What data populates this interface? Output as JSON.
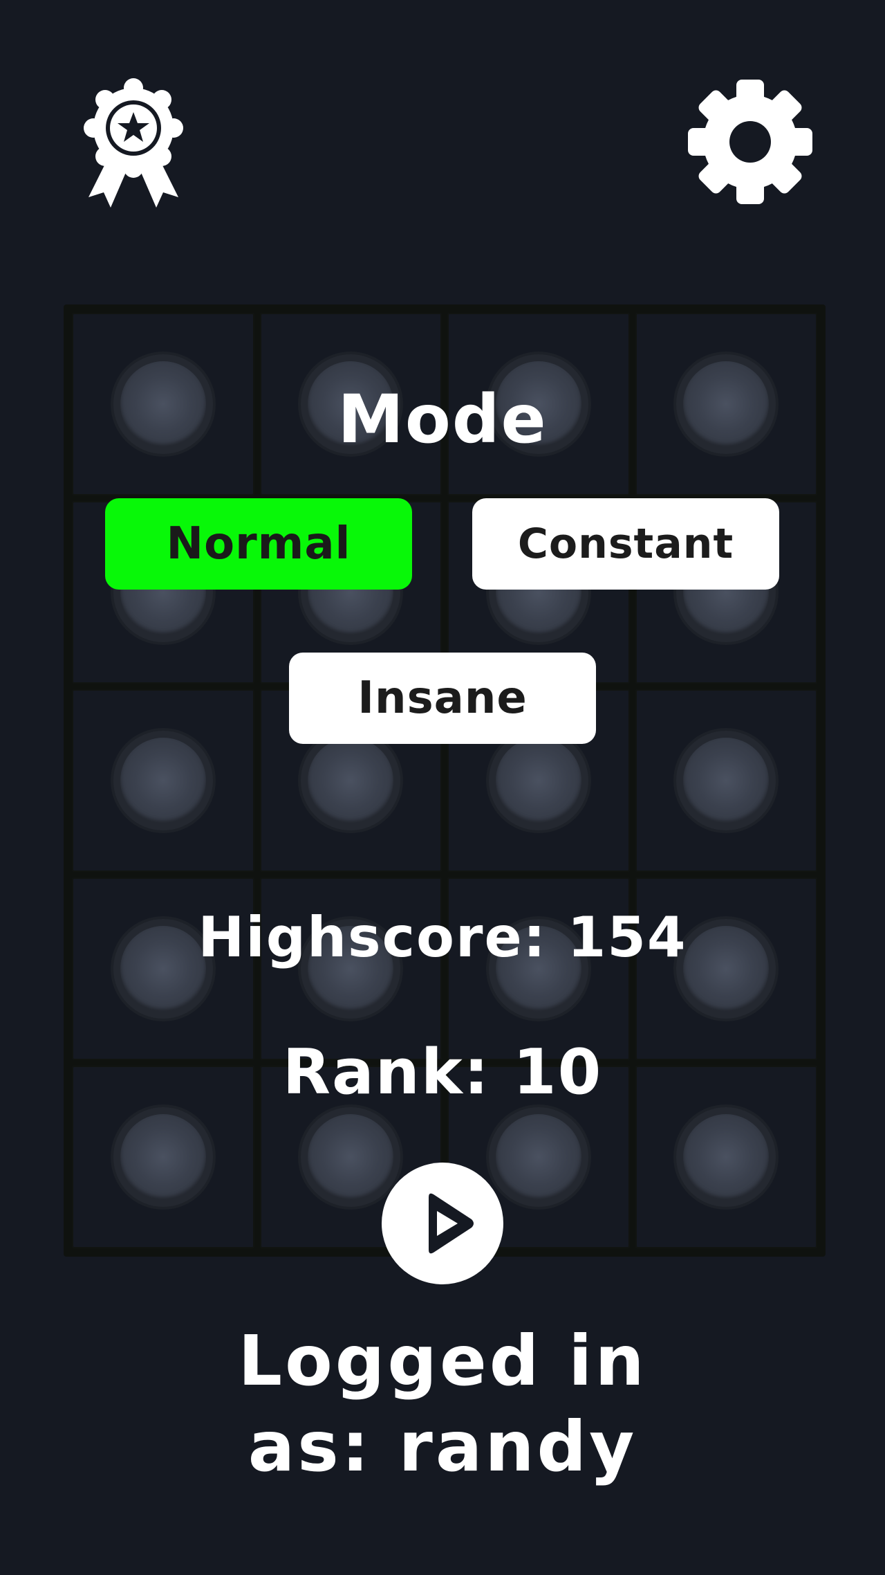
{
  "icons": {
    "achievements": "award-ribbon-icon",
    "settings": "gear-icon",
    "play": "play-icon"
  },
  "colors": {
    "background": "#151922",
    "selected_mode": "#08f808",
    "button": "#ffffff",
    "text": "#ffffff"
  },
  "menu": {
    "title": "Mode",
    "modes": [
      {
        "label": "Normal",
        "selected": true
      },
      {
        "label": "Constant",
        "selected": false
      },
      {
        "label": "Insane",
        "selected": false
      }
    ]
  },
  "stats": {
    "highscore": "Highscore: 154",
    "rank": "Rank: 10"
  },
  "login": {
    "line1": "Logged in",
    "line2": "as: randy"
  }
}
